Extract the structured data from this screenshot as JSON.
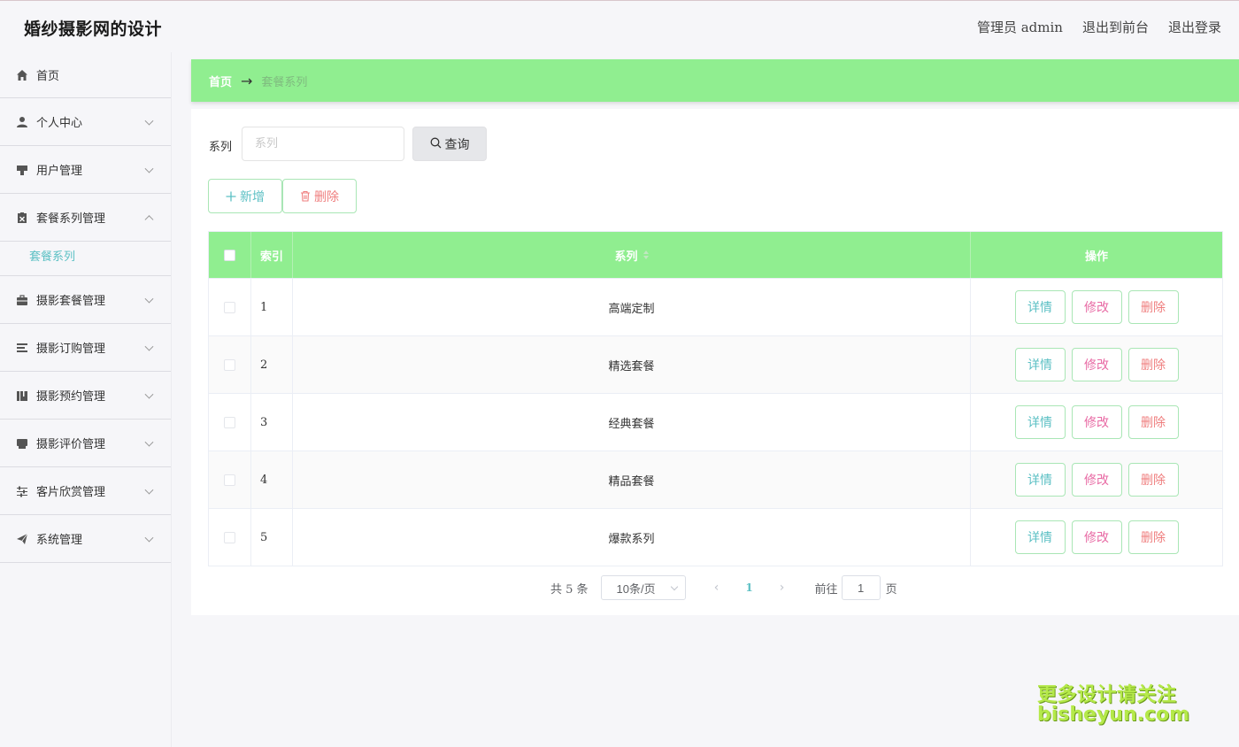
{
  "header": {
    "title": "婚纱摄影网的设计",
    "admin_label": "管理员 admin",
    "front_label": "退出到前台",
    "logout_label": "退出登录"
  },
  "sidebar": {
    "items": [
      {
        "label": "首页",
        "icon": "home-icon"
      },
      {
        "label": "个人中心",
        "icon": "user-icon"
      },
      {
        "label": "用户管理",
        "icon": "users-manage-icon"
      },
      {
        "label": "套餐系列管理",
        "icon": "clipboard-icon",
        "expanded": true
      },
      {
        "label": "摄影套餐管理",
        "icon": "briefcase-icon"
      },
      {
        "label": "摄影订购管理",
        "icon": "list-icon"
      },
      {
        "label": "摄影预约管理",
        "icon": "book-icon"
      },
      {
        "label": "摄影评价管理",
        "icon": "inbox-icon"
      },
      {
        "label": "客片欣赏管理",
        "icon": "sliders-icon"
      },
      {
        "label": "系统管理",
        "icon": "paper-plane-icon"
      }
    ],
    "submenu_active": "套餐系列"
  },
  "breadcrumb": {
    "home": "首页",
    "current": "套餐系列"
  },
  "search": {
    "label": "系列",
    "placeholder": "系列",
    "value": "",
    "button_label": "查询"
  },
  "actions": {
    "add_label": "新增",
    "delete_label": "删除"
  },
  "table": {
    "headers": {
      "index": "索引",
      "series": "系列",
      "ops": "操作"
    },
    "rows": [
      {
        "index": "1",
        "series": "高端定制"
      },
      {
        "index": "2",
        "series": "精选套餐"
      },
      {
        "index": "3",
        "series": "经典套餐"
      },
      {
        "index": "4",
        "series": "精品套餐"
      },
      {
        "index": "5",
        "series": "爆款系列"
      }
    ],
    "op_detail": "详情",
    "op_edit": "修改",
    "op_delete": "删除"
  },
  "pagination": {
    "total": "共 5 条",
    "page_size": "10条/页",
    "current_page": "1",
    "goto_label": "前往",
    "goto_value": "1",
    "page_unit": "页"
  },
  "watermark": {
    "line1": "更多设计请关注",
    "line2": "bisheyun.com"
  },
  "colors": {
    "accent_green": "#90ee90",
    "teal_text": "#5cc0c4",
    "pink_text": "#e86aa4",
    "red_text": "#ef7e7e"
  }
}
